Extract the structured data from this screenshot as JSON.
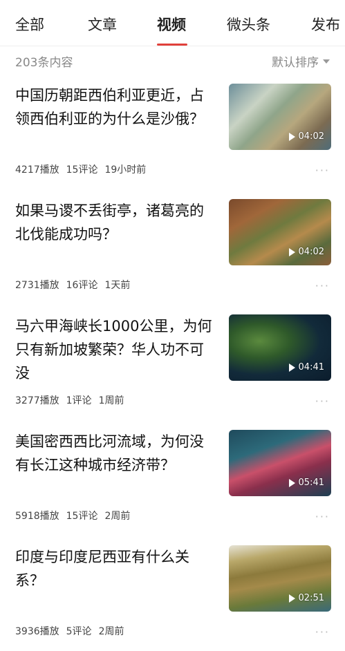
{
  "tabs": [
    {
      "label": "全部"
    },
    {
      "label": "文章"
    },
    {
      "label": "视频"
    },
    {
      "label": "微头条"
    },
    {
      "label": "发布"
    }
  ],
  "active_tab": "视频",
  "accent_color": "#e0403a",
  "subbar": {
    "count_label": "203条内容",
    "sort_label": "默认排序"
  },
  "items": [
    {
      "title": "中国历朝距西伯利亚更近，占领西伯利亚的为什么是沙俄？",
      "plays": "4217播放",
      "comments": "15评论",
      "time": "19小时前",
      "duration": "04:02"
    },
    {
      "title": "如果马谡不丢街亭，诸葛亮的北伐能成功吗？",
      "plays": "2731播放",
      "comments": "16评论",
      "time": "1天前",
      "duration": "04:02"
    },
    {
      "title": "马六甲海峡长1000公里，为何只有新加坡繁荣？华人功不可没",
      "plays": "3277播放",
      "comments": "1评论",
      "time": "1周前",
      "duration": "04:41"
    },
    {
      "title": "美国密西西比河流域，为何没有长江这种城市经济带？",
      "plays": "5918播放",
      "comments": "15评论",
      "time": "2周前",
      "duration": "05:41"
    },
    {
      "title": "印度与印度尼西亚有什么关系？",
      "plays": "3936播放",
      "comments": "5评论",
      "time": "2周前",
      "duration": "02:51"
    }
  ],
  "more_label": "···"
}
